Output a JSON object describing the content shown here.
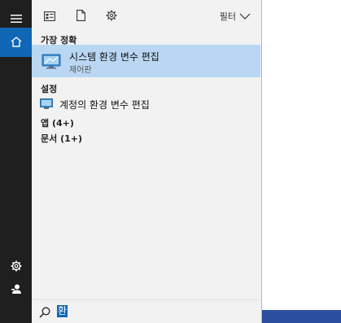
{
  "panel": {
    "filter_label": "필터",
    "sections": {
      "best_match": "가장 정확",
      "settings": "설정",
      "apps": "앱 (4+)",
      "documents": "문서 (1+)"
    },
    "best_match_item": {
      "title": "시스템 환경 변수 편집",
      "subtitle": "제어판",
      "icon": "monitor-settings-icon"
    },
    "settings_item": {
      "label": "계정의 환경 변수 편집",
      "icon": "monitor-icon"
    }
  },
  "search": {
    "query": "환"
  },
  "colors": {
    "rail": "#1f1f1f",
    "accent": "#0f67b5",
    "selected": "#b9d7f2",
    "panel": "#f2f2f2",
    "taskbar": "#2b4f9e"
  }
}
